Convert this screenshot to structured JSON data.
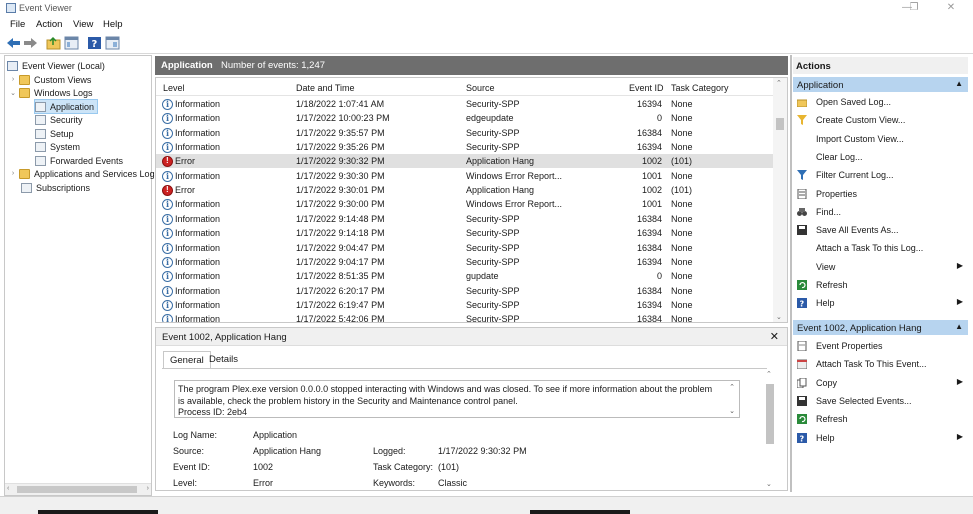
{
  "window": {
    "title": "Event Viewer"
  },
  "menu": [
    "File",
    "Action",
    "View",
    "Help"
  ],
  "icons": {
    "back": "back-arrow-icon",
    "forward": "forward-arrow-icon",
    "up": "up-folder-icon",
    "show_hide": "show-hide-console-tree-icon",
    "help": "help-icon",
    "action_pane": "show-hide-action-pane-icon"
  },
  "tree": [
    {
      "label": "Event Viewer (Local)",
      "icon": "event-viewer-icon"
    },
    {
      "label": "Custom Views",
      "icon": "folder-icon"
    },
    {
      "label": "Windows Logs",
      "icon": "folder-icon"
    },
    {
      "label": "Application",
      "icon": "log-icon"
    },
    {
      "label": "Security",
      "icon": "log-icon"
    },
    {
      "label": "Setup",
      "icon": "log-icon"
    },
    {
      "label": "System",
      "icon": "log-icon"
    },
    {
      "label": "Forwarded Events",
      "icon": "log-icon"
    },
    {
      "label": "Applications and Services Log",
      "icon": "folder-icon"
    },
    {
      "label": "Subscriptions",
      "icon": "log-icon"
    }
  ],
  "center": {
    "log_name": "Application",
    "count_text": "Number of events: 1,247"
  },
  "columns": {
    "level": "Level",
    "datetime": "Date and Time",
    "source": "Source",
    "event_id": "Event ID",
    "task": "Task Category"
  },
  "events": [
    {
      "level": "Information",
      "datetime": "1/18/2022 1:07:41 AM",
      "source": "Security-SPP",
      "event_id": "16394",
      "task": "None"
    },
    {
      "level": "Information",
      "datetime": "1/17/2022 10:00:23 PM",
      "source": "edgeupdate",
      "event_id": "0",
      "task": "None"
    },
    {
      "level": "Information",
      "datetime": "1/17/2022 9:35:57 PM",
      "source": "Security-SPP",
      "event_id": "16384",
      "task": "None"
    },
    {
      "level": "Information",
      "datetime": "1/17/2022 9:35:26 PM",
      "source": "Security-SPP",
      "event_id": "16394",
      "task": "None"
    },
    {
      "level": "Error",
      "datetime": "1/17/2022 9:30:32 PM",
      "source": "Application Hang",
      "event_id": "1002",
      "task": "(101)"
    },
    {
      "level": "Information",
      "datetime": "1/17/2022 9:30:30 PM",
      "source": "Windows Error Report...",
      "event_id": "1001",
      "task": "None"
    },
    {
      "level": "Error",
      "datetime": "1/17/2022 9:30:01 PM",
      "source": "Application Hang",
      "event_id": "1002",
      "task": "(101)"
    },
    {
      "level": "Information",
      "datetime": "1/17/2022 9:30:00 PM",
      "source": "Windows Error Report...",
      "event_id": "1001",
      "task": "None"
    },
    {
      "level": "Information",
      "datetime": "1/17/2022 9:14:48 PM",
      "source": "Security-SPP",
      "event_id": "16384",
      "task": "None"
    },
    {
      "level": "Information",
      "datetime": "1/17/2022 9:14:18 PM",
      "source": "Security-SPP",
      "event_id": "16394",
      "task": "None"
    },
    {
      "level": "Information",
      "datetime": "1/17/2022 9:04:47 PM",
      "source": "Security-SPP",
      "event_id": "16384",
      "task": "None"
    },
    {
      "level": "Information",
      "datetime": "1/17/2022 9:04:17 PM",
      "source": "Security-SPP",
      "event_id": "16394",
      "task": "None"
    },
    {
      "level": "Information",
      "datetime": "1/17/2022 8:51:35 PM",
      "source": "gupdate",
      "event_id": "0",
      "task": "None"
    },
    {
      "level": "Information",
      "datetime": "1/17/2022 6:20:17 PM",
      "source": "Security-SPP",
      "event_id": "16384",
      "task": "None"
    },
    {
      "level": "Information",
      "datetime": "1/17/2022 6:19:47 PM",
      "source": "Security-SPP",
      "event_id": "16394",
      "task": "None"
    },
    {
      "level": "Information",
      "datetime": "1/17/2022 5:42:06 PM",
      "source": "Security-SPP",
      "event_id": "16384",
      "task": "None"
    }
  ],
  "detail": {
    "title": "Event 1002, Application Hang",
    "tabs": [
      "General",
      "Details"
    ],
    "description": "The program Plex.exe version 0.0.0.0 stopped interacting with Windows and was closed. To see if more information about the problem is available, check the problem history in the Security and Maintenance control panel.\nProcess ID: 2eb4",
    "fields": {
      "log_name_label": "Log Name:",
      "log_name": "Application",
      "source_label": "Source:",
      "source": "Application Hang",
      "logged_label": "Logged:",
      "logged": "1/17/2022 9:30:32 PM",
      "event_id_label": "Event ID:",
      "event_id": "1002",
      "task_label": "Task Category:",
      "task": "(101)",
      "level_label": "Level:",
      "level": "Error",
      "keywords_label": "Keywords:",
      "keywords": "Classic"
    }
  },
  "actions": {
    "title": "Actions",
    "section1": {
      "label": "Application",
      "items": [
        {
          "label": "Open Saved Log...",
          "icon": "open-folder-icon"
        },
        {
          "label": "Create Custom View...",
          "icon": "filter-create-icon"
        },
        {
          "label": "Import Custom View...",
          "icon": ""
        },
        {
          "label": "Clear Log...",
          "icon": ""
        },
        {
          "label": "Filter Current Log...",
          "icon": "filter-icon"
        },
        {
          "label": "Properties",
          "icon": "properties-icon"
        },
        {
          "label": "Find...",
          "icon": "binoculars-icon"
        },
        {
          "label": "Save All Events As...",
          "icon": "save-icon"
        },
        {
          "label": "Attach a Task To this Log...",
          "icon": ""
        },
        {
          "label": "View",
          "icon": "",
          "submenu": true
        },
        {
          "label": "Refresh",
          "icon": "refresh-icon"
        },
        {
          "label": "Help",
          "icon": "help-icon",
          "submenu": true
        }
      ]
    },
    "section2": {
      "label": "Event 1002, Application Hang",
      "items": [
        {
          "label": "Event Properties",
          "icon": "event-properties-icon"
        },
        {
          "label": "Attach Task To This Event...",
          "icon": "task-icon"
        },
        {
          "label": "Copy",
          "icon": "copy-icon",
          "submenu": true
        },
        {
          "label": "Save Selected Events...",
          "icon": "save-icon"
        },
        {
          "label": "Refresh",
          "icon": "refresh-icon"
        },
        {
          "label": "Help",
          "icon": "help-icon",
          "submenu": true
        }
      ]
    }
  },
  "colors": {
    "selection": "#cce4f7",
    "section_header": "#b7d4ef",
    "header_bar": "#6e6e6e",
    "error": "#cc2222",
    "info": "#3a6ea5"
  }
}
